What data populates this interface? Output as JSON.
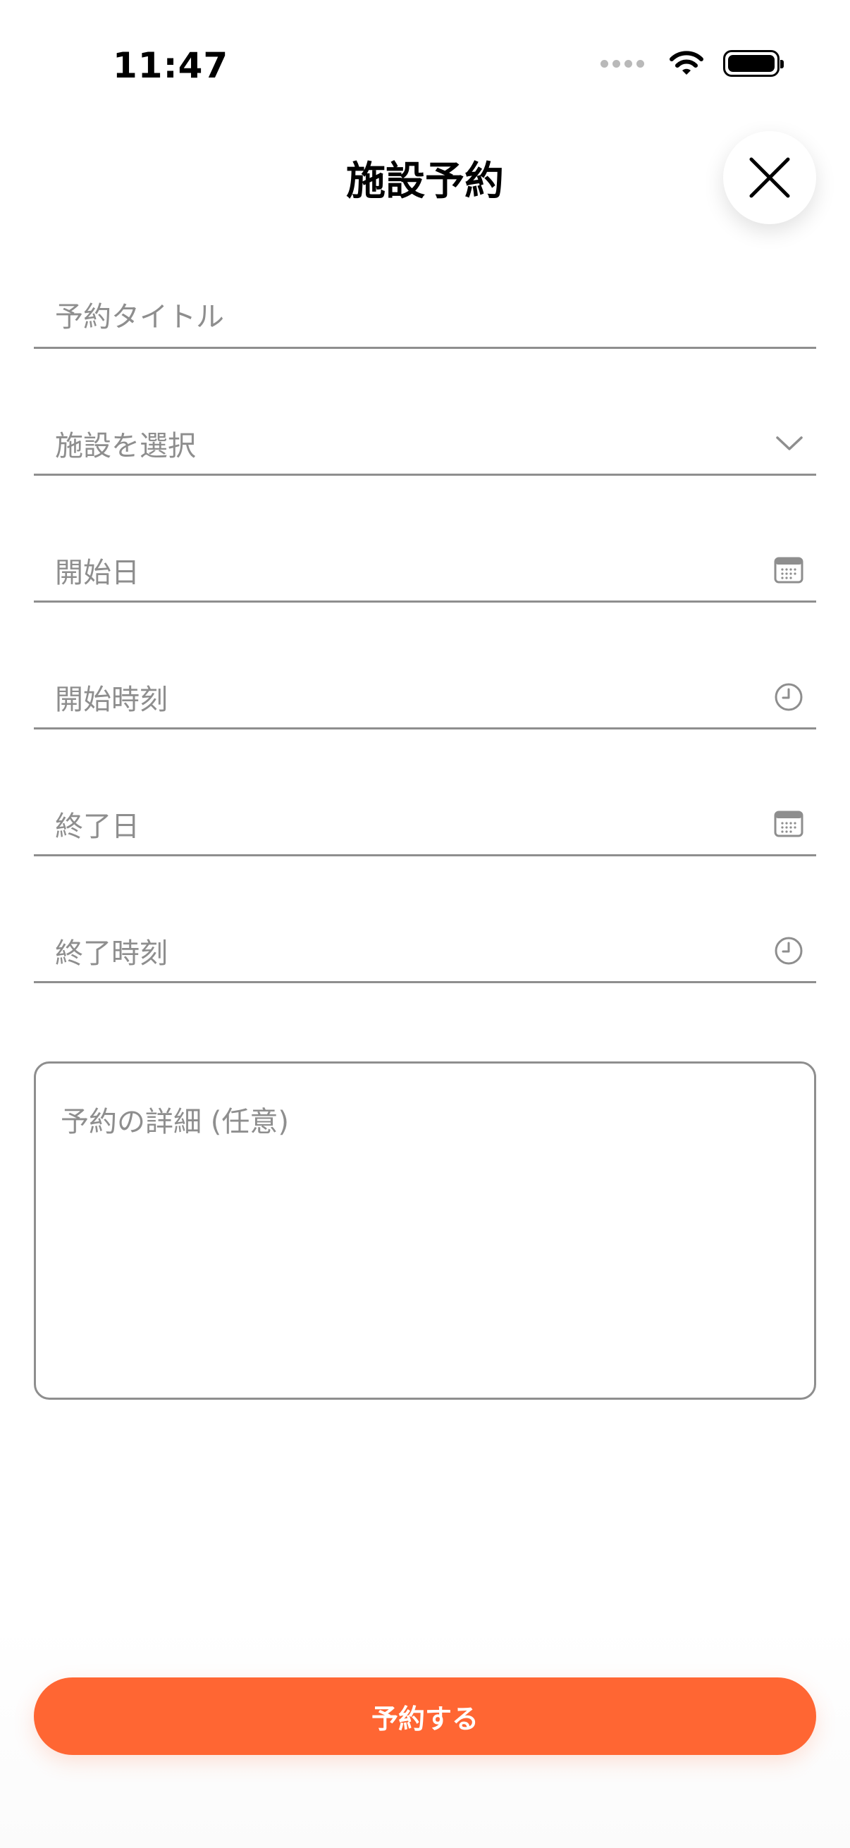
{
  "status_bar": {
    "time": "11:47",
    "icons": [
      "signal-icon",
      "wifi-icon",
      "battery-icon"
    ]
  },
  "header": {
    "title": "施設予約",
    "close_icon": "close-icon"
  },
  "form": {
    "title_placeholder": "予約タイトル",
    "facility_placeholder": "施設を選択",
    "start_date_placeholder": "開始日",
    "start_time_placeholder": "開始時刻",
    "end_date_placeholder": "終了日",
    "end_time_placeholder": "終了時刻",
    "details_placeholder": "予約の詳細 (任意)"
  },
  "actions": {
    "submit_label": "予約する"
  },
  "colors": {
    "accent": "#ff6633",
    "field_gray": "#8e8e8e"
  }
}
